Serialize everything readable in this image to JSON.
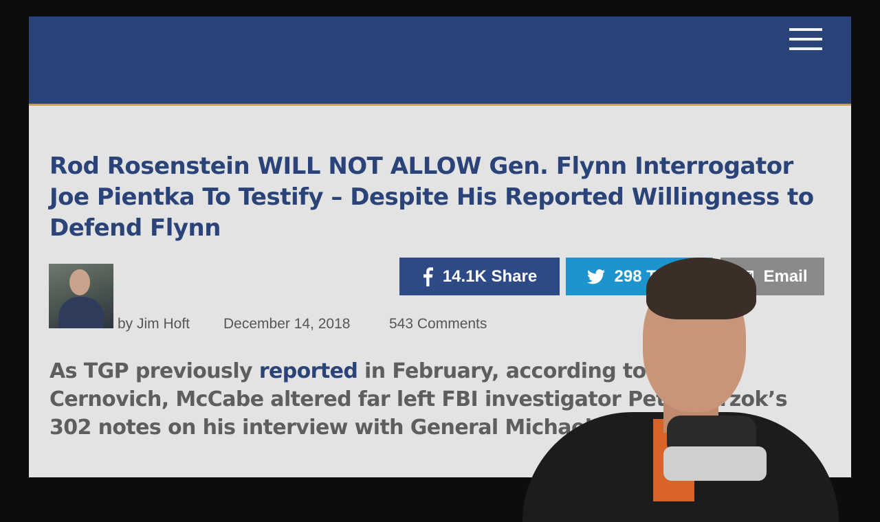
{
  "header": {
    "menu_icon": "hamburger-menu-icon"
  },
  "article": {
    "headline": "Rod Rosenstein WILL NOT ALLOW Gen. Flynn Interrogator Joe Pientka To Testify – Despite His Reported Willingness to Defend Flynn",
    "author": "by Jim Hoft",
    "date": "December 14, 2018",
    "comments": "543 Comments",
    "body": {
      "before_link": "As TGP previously ",
      "link_text": "reported",
      "after_link": " in February, according to Mike Cernovich, McCabe altered far left FBI investigator Peter Strzok’s 302 notes on his interview with General Michael Flynn."
    }
  },
  "share": {
    "facebook": {
      "label": "14.1K Share",
      "icon": "facebook-icon",
      "color": "#2e4a86"
    },
    "twitter": {
      "label": "298 Tweet",
      "icon": "twitter-icon",
      "color": "#1e94cf"
    },
    "email": {
      "label": "Email",
      "icon": "email-icon",
      "color": "#8a8a8a"
    }
  },
  "colors": {
    "header_bg": "#2a4378",
    "header_accent": "#c8a34e",
    "headline": "#2a4378",
    "page_bg": "#e3e3e3"
  }
}
